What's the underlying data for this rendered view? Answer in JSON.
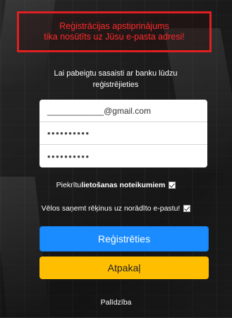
{
  "alert": {
    "line1": "Reģistrācijas apstiprinājums",
    "line2": "tika nosūtīts uz Jūsu e-pasta adresi!"
  },
  "intro": {
    "line1": "Lai pabeigtu sasaisti ar banku lūdzu",
    "line2": "reģistrējieties"
  },
  "form": {
    "email_value": "____________@gmail.com",
    "password_value": "••••••••••",
    "password_confirm_value": "••••••••••"
  },
  "terms": {
    "prefix": "Piekrītu ",
    "link": "lietošanas noteikumiem",
    "checked": true
  },
  "invoices": {
    "label": "Vēlos saņemt rēķinus uz norādīto e-pastu!",
    "checked": true
  },
  "buttons": {
    "register_label": "Reģistrēties",
    "back_label": "Atpakaļ"
  },
  "footer": {
    "help_label": "Palīdzība"
  },
  "colors": {
    "alert_red": "#ff2a2a",
    "primary_blue": "#1a8cff",
    "secondary_yellow": "#ffbf00"
  }
}
